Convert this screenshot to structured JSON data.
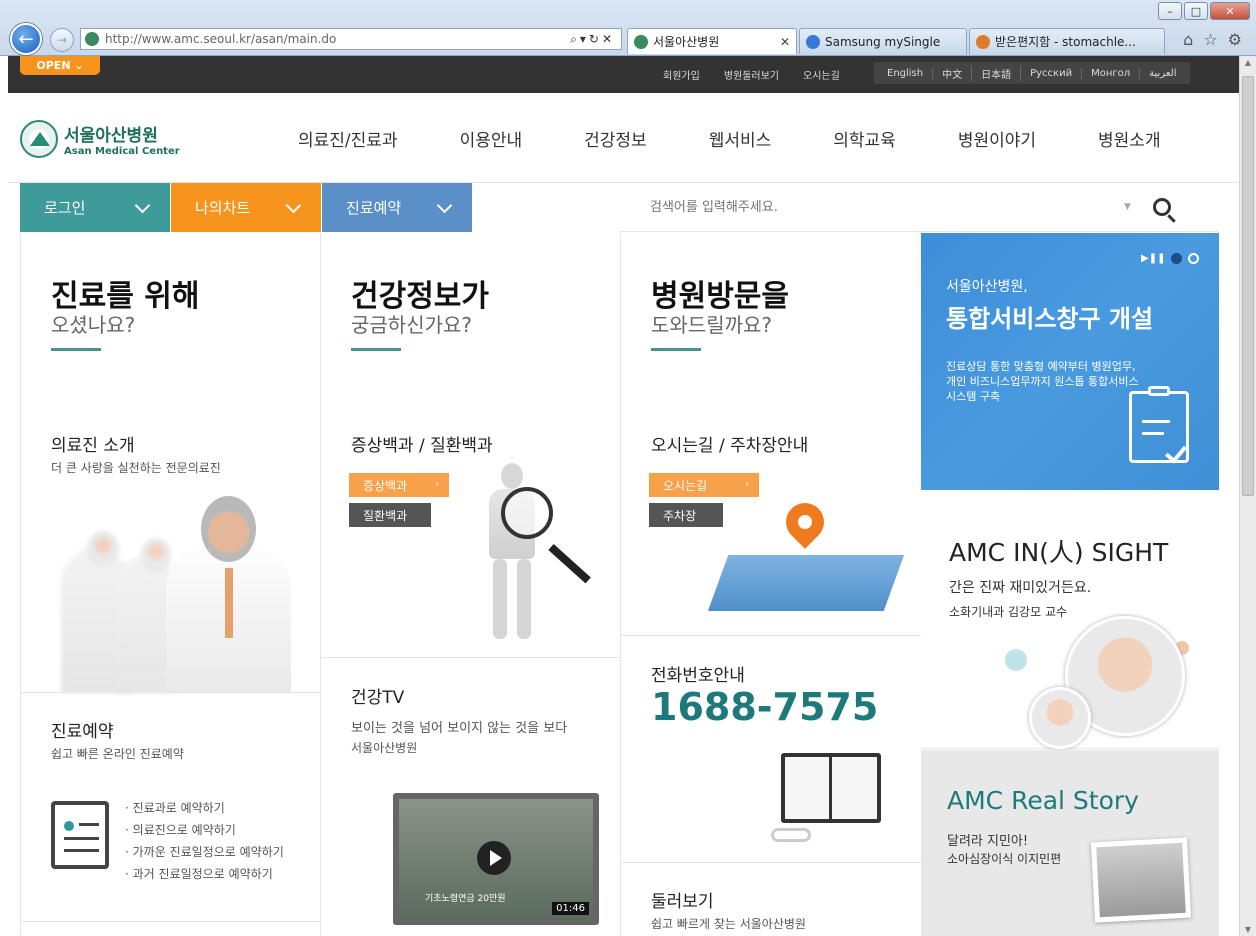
{
  "browser": {
    "url": "http://www.amc.seoul.kr/asan/main.do",
    "tabs": [
      {
        "label": "서울아산병원",
        "active": true
      },
      {
        "label": "Samsung mySingle",
        "active": false
      },
      {
        "label": "받은편지함 - stomachle...",
        "active": false
      }
    ]
  },
  "topbar": {
    "open_label": "OPEN",
    "util": [
      "회원가입",
      "병원둘러보기",
      "오시는길"
    ],
    "langs": [
      "English",
      "中文",
      "日本語",
      "Русский",
      "Монгол",
      "العربية"
    ]
  },
  "logo": {
    "kor": "서울아산병원",
    "eng": "Asan Medical Center"
  },
  "gnb": [
    "의료진/진료과",
    "이용안내",
    "건강정보",
    "웹서비스",
    "의학교육",
    "병원이야기",
    "병원소개"
  ],
  "quick": [
    {
      "label": "로그인",
      "color": "#3f9a9a"
    },
    {
      "label": "나의차트",
      "color": "#f7941d"
    },
    {
      "label": "진료예약",
      "color": "#5b8fc7"
    }
  ],
  "search": {
    "placeholder": "검색어를 입력해주세요."
  },
  "col1": {
    "title": "진료를 위해",
    "sub": "오셨나요?",
    "sec1_title": "의료진 소개",
    "sec1_sub": "더 큰 사랑을 실천하는 전문의료진",
    "sec2_title": "진료예약",
    "sec2_sub": "쉽고 빠른 온라인 진료예약",
    "links": [
      "· 진료과로 예약하기",
      "· 의료진으로 예약하기",
      "· 가까운 진료일정으로 예약하기",
      "· 과거 진료일정으로 예약하기"
    ]
  },
  "col2": {
    "title": "건강정보가",
    "sub": "궁금하신가요?",
    "sec1_title": "증상백과 / 질환백과",
    "pill1": "증상백과",
    "pill2": "질환백과",
    "sec2_title": "건강TV",
    "sec2_sub": "보이는 것을 넘어 보이지 않는 것을 보다",
    "sec2_sub2": "서울아산병원",
    "video_time": "01:46",
    "video_caption": "기초노령연금 20만원"
  },
  "col3": {
    "title": "병원방문을",
    "sub": "도와드릴까요?",
    "sec1_title": "오시는길 / 주차장안내",
    "pill1": "오시는길",
    "pill2": "주차장",
    "sec2_title": "전화번호안내",
    "phone": "1688-7575",
    "sec3_title": "둘러보기",
    "sec3_sub": "쉽고 빠르게 찾는 서울아산병원"
  },
  "banner1": {
    "t1": "서울아산병원,",
    "t2": "통합서비스창구 개설",
    "t3": "진료상담 통한 맞춤형 예약부터 병원업무, 개인 비즈니스업무까지 원스톱 통합서비스 시스템 구축"
  },
  "banner2": {
    "title": "AMC IN(人) SIGHT",
    "sub": "간은 진짜 재미있거든요.",
    "sub2": "소화기내과 김강모 교수"
  },
  "banner3": {
    "title": "AMC Real Story",
    "sub": "달려라 지민아!",
    "sub2": "소아심장이식 이지민편"
  }
}
